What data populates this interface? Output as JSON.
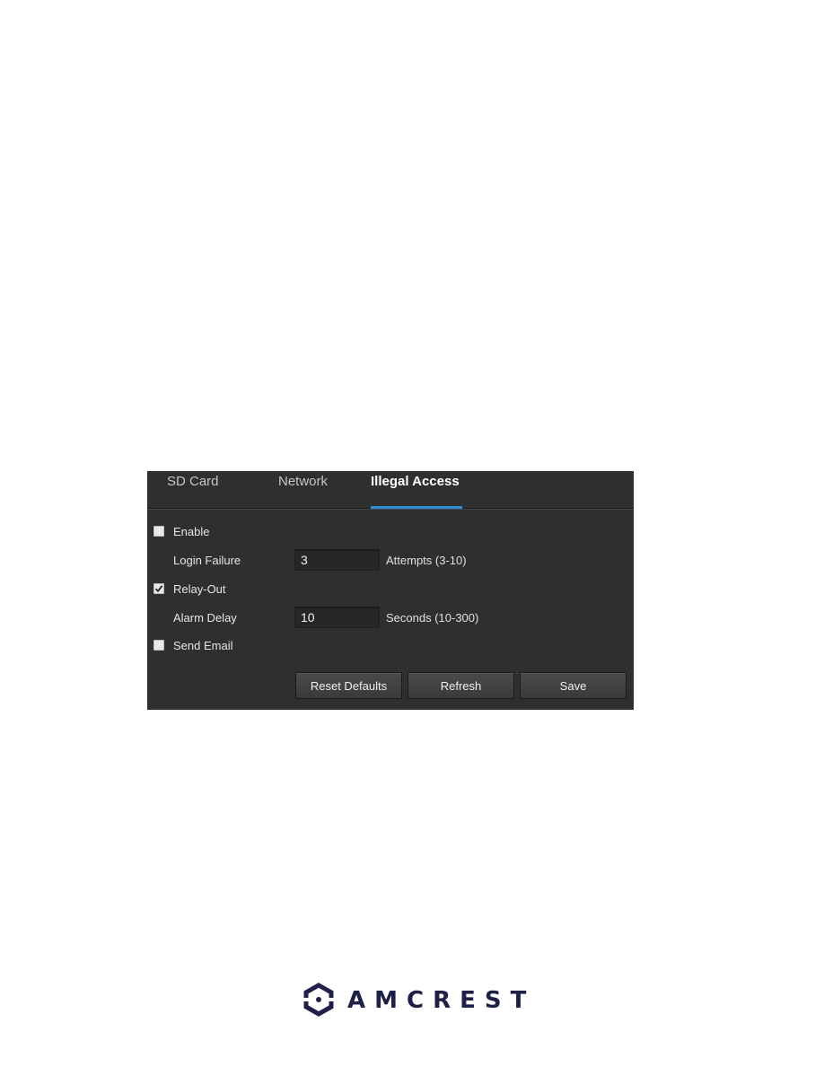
{
  "tabs": [
    {
      "label": "SD Card",
      "active": false
    },
    {
      "label": "Network",
      "active": false
    },
    {
      "label": "Illegal Access",
      "active": true
    }
  ],
  "form": {
    "enable": {
      "label": "Enable",
      "checked": false
    },
    "login_failure": {
      "label": "Login Failure",
      "value": "3",
      "hint": "Attempts (3-10)"
    },
    "relay_out": {
      "label": "Relay-Out",
      "checked": true
    },
    "alarm_delay": {
      "label": "Alarm Delay",
      "value": "10",
      "hint": "Seconds (10-300)"
    },
    "send_email": {
      "label": "Send Email",
      "checked": false
    }
  },
  "buttons": {
    "reset_defaults": "Reset Defaults",
    "refresh": "Refresh",
    "save": "Save"
  },
  "colors": {
    "panel_bg": "#2f2f2f",
    "tab_active_underline": "#2a8fd6",
    "logo": "#1e2147",
    "logo_accent": "#2a8fd6"
  },
  "footer": {
    "logo_text": "AMCREST",
    "logo_icon": "hexagon-camera-icon"
  }
}
